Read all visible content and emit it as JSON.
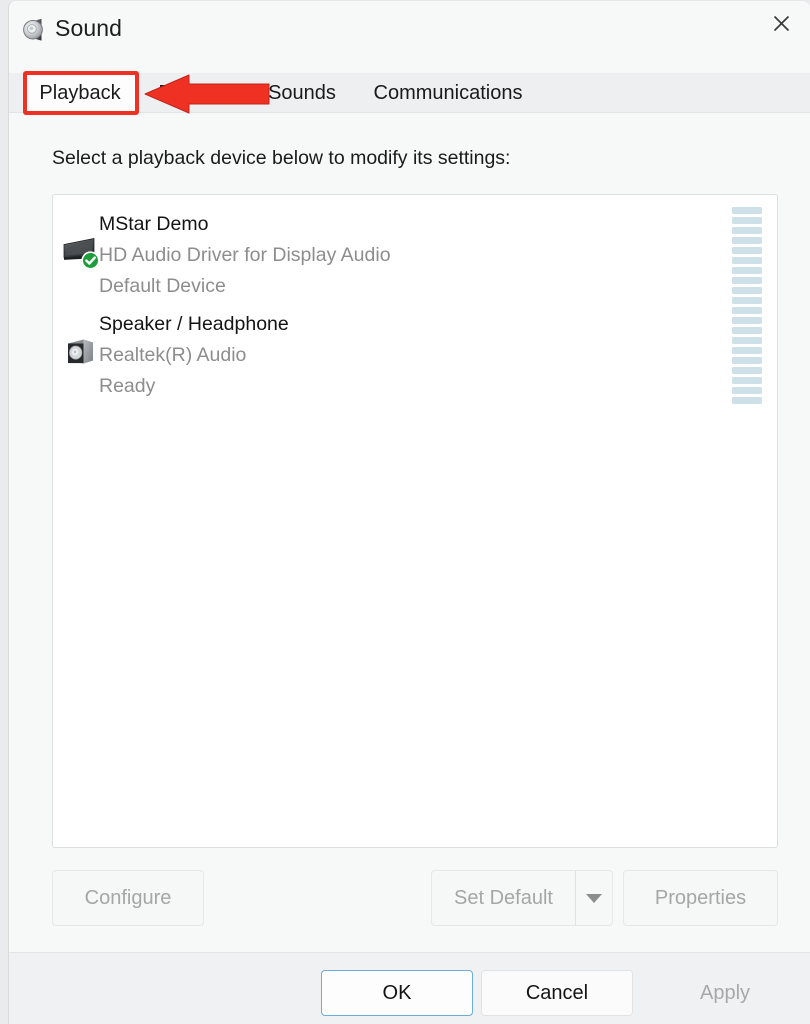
{
  "window": {
    "title": "Sound",
    "icon": "speaker-icon",
    "close_label": "✕"
  },
  "tabs": [
    {
      "label": "Playback",
      "active": true
    },
    {
      "label": "Recording",
      "active": false
    },
    {
      "label": "Sounds",
      "active": false
    },
    {
      "label": "Communications",
      "active": false
    }
  ],
  "annotation": {
    "highlight_color": "#ef3124",
    "arrow_color": "#ef3124",
    "highlighted_tab": "Playback"
  },
  "main": {
    "instruction": "Select a playback device below to modify its settings:",
    "devices": [
      {
        "name": "MStar Demo",
        "driver": "HD Audio Driver for Display Audio",
        "status": "Default Device",
        "icon": "monitor-icon",
        "badge": "green-check-badge",
        "meter_segments": 10,
        "meter_level": 0
      },
      {
        "name": "Speaker / Headphone",
        "driver": "Realtek(R) Audio",
        "status": "Ready",
        "icon": "speaker-box-icon",
        "badge": "",
        "meter_segments": 10,
        "meter_level": 0
      }
    ]
  },
  "action_buttons": {
    "configure": "Configure",
    "set_default": "Set Default",
    "set_default_caret": "dropdown-caret",
    "properties": "Properties"
  },
  "footer_buttons": {
    "ok": "OK",
    "cancel": "Cancel",
    "apply": "Apply"
  },
  "colors": {
    "accent_focus": "#6cacdf",
    "meter_segment": "#cfe1e8",
    "annotation_red": "#ef3124",
    "default_badge_green": "#28a745"
  }
}
